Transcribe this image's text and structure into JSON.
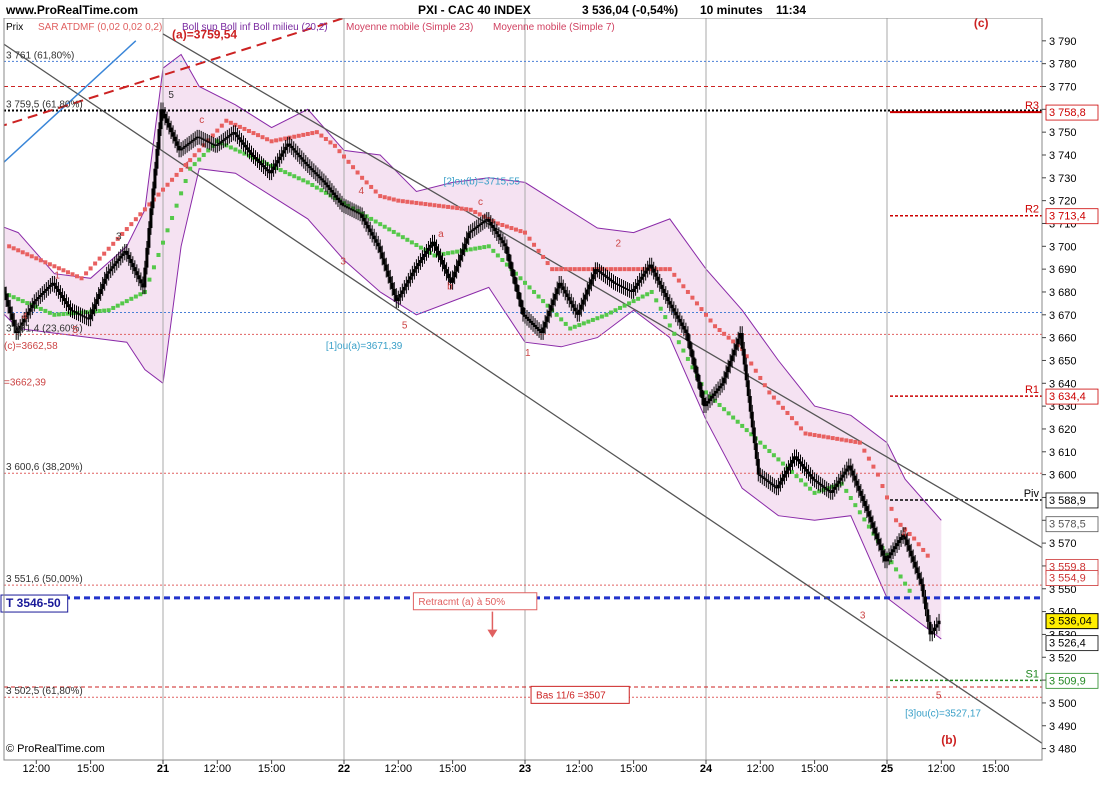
{
  "header": {
    "site": "www.ProRealTime.com",
    "symbol": "PXI - CAC 40 INDEX",
    "last": "3 536,04 (-0,54%)",
    "period": "10 minutes",
    "time": "11:34"
  },
  "legend": {
    "prix": "Prix",
    "sar": "SAR ATDMF (0,02 0,02 0,2)",
    "boll": "Boll sup Boll inf Boll milieu (20,2)",
    "mm23": "Moyenne mobile (Simple 23)",
    "mm7": "Moyenne mobile (Simple 7)"
  },
  "footer": {
    "copyright": "© ProRealTime.com"
  },
  "colors": {
    "candle": "#000000",
    "boll_fill": "#f5e2f2",
    "boll_line": "#8a2aa8",
    "sar_red": "#e86060",
    "sar_green": "#55c84a",
    "channel": "#555555",
    "fib": "#e06060",
    "support_blue": "#2233cc",
    "pivot": "#000000",
    "resistance": "#cc0000",
    "s1": "#228822",
    "price_box": "#ffee00"
  },
  "chart_data": {
    "type": "candlestick",
    "title": "PXI - CAC 40 INDEX",
    "ylim": [
      3475,
      3800
    ],
    "yticks": [
      "3 480",
      "3 490",
      "3 500",
      "3 510",
      "3 520",
      "3 530",
      "3 540",
      "3 550",
      "3 560",
      "3 570",
      "3 580",
      "3 590",
      "3 600",
      "3 610",
      "3 620",
      "3 630",
      "3 640",
      "3 650",
      "3 660",
      "3 670",
      "3 680",
      "3 690",
      "3 700",
      "3 710",
      "3 720",
      "3 730",
      "3 740",
      "3 750",
      "3 760",
      "3 770",
      "3 780",
      "3 790"
    ],
    "xticks": [
      {
        "label": "12:00",
        "x": 0.3
      },
      {
        "label": "15:00",
        "x": 0.6
      },
      {
        "label": "21",
        "x": 1.0
      },
      {
        "label": "12:00",
        "x": 1.3
      },
      {
        "label": "15:00",
        "x": 1.6
      },
      {
        "label": "22",
        "x": 2.0
      },
      {
        "label": "12:00",
        "x": 2.3
      },
      {
        "label": "15:00",
        "x": 2.6
      },
      {
        "label": "23",
        "x": 3.0
      },
      {
        "label": "12:00",
        "x": 3.3
      },
      {
        "label": "15:00",
        "x": 3.6
      },
      {
        "label": "24",
        "x": 4.0
      },
      {
        "label": "12:00",
        "x": 4.3
      },
      {
        "label": "15:00",
        "x": 4.6
      },
      {
        "label": "25",
        "x": 5.0
      },
      {
        "label": "12:00",
        "x": 5.3
      },
      {
        "label": "15:00",
        "x": 5.6
      }
    ],
    "day_separators": [
      1.0,
      2.0,
      3.0,
      4.0,
      5.0
    ],
    "close_path": [
      [
        0.0,
        3698
      ],
      [
        0.1,
        3688
      ],
      [
        0.2,
        3662
      ],
      [
        0.3,
        3676
      ],
      [
        0.4,
        3684
      ],
      [
        0.5,
        3672
      ],
      [
        0.6,
        3668
      ],
      [
        0.7,
        3688
      ],
      [
        0.8,
        3698
      ],
      [
        0.9,
        3682
      ],
      [
        1.0,
        3760
      ],
      [
        1.1,
        3742
      ],
      [
        1.2,
        3748
      ],
      [
        1.3,
        3744
      ],
      [
        1.4,
        3750
      ],
      [
        1.5,
        3740
      ],
      [
        1.6,
        3732
      ],
      [
        1.7,
        3745
      ],
      [
        1.8,
        3736
      ],
      [
        1.9,
        3728
      ],
      [
        2.0,
        3718
      ],
      [
        2.1,
        3714
      ],
      [
        2.2,
        3700
      ],
      [
        2.3,
        3676
      ],
      [
        2.4,
        3690
      ],
      [
        2.5,
        3702
      ],
      [
        2.6,
        3684
      ],
      [
        2.7,
        3706
      ],
      [
        2.8,
        3712
      ],
      [
        2.9,
        3700
      ],
      [
        3.0,
        3670
      ],
      [
        3.1,
        3662
      ],
      [
        3.2,
        3684
      ],
      [
        3.3,
        3670
      ],
      [
        3.4,
        3690
      ],
      [
        3.5,
        3684
      ],
      [
        3.6,
        3680
      ],
      [
        3.7,
        3692
      ],
      [
        3.8,
        3676
      ],
      [
        3.9,
        3662
      ],
      [
        4.0,
        3630
      ],
      [
        4.1,
        3640
      ],
      [
        4.2,
        3662
      ],
      [
        4.3,
        3600
      ],
      [
        4.4,
        3594
      ],
      [
        4.5,
        3608
      ],
      [
        4.6,
        3598
      ],
      [
        4.7,
        3592
      ],
      [
        4.8,
        3604
      ],
      [
        4.9,
        3584
      ],
      [
        5.0,
        3562
      ],
      [
        5.1,
        3574
      ],
      [
        5.2,
        3552
      ],
      [
        5.25,
        3530
      ],
      [
        5.3,
        3536
      ]
    ],
    "bollinger_upper": [
      [
        0.0,
        3712
      ],
      [
        0.2,
        3706
      ],
      [
        0.4,
        3688
      ],
      [
        0.6,
        3686
      ],
      [
        0.8,
        3700
      ],
      [
        0.9,
        3716
      ],
      [
        1.0,
        3778
      ],
      [
        1.1,
        3784
      ],
      [
        1.2,
        3770
      ],
      [
        1.4,
        3762
      ],
      [
        1.6,
        3752
      ],
      [
        1.8,
        3760
      ],
      [
        2.0,
        3742
      ],
      [
        2.2,
        3740
      ],
      [
        2.4,
        3724
      ],
      [
        2.6,
        3728
      ],
      [
        2.8,
        3730
      ],
      [
        3.0,
        3728
      ],
      [
        3.2,
        3718
      ],
      [
        3.4,
        3708
      ],
      [
        3.6,
        3706
      ],
      [
        3.8,
        3712
      ],
      [
        4.0,
        3690
      ],
      [
        4.2,
        3672
      ],
      [
        4.4,
        3650
      ],
      [
        4.6,
        3630
      ],
      [
        4.8,
        3626
      ],
      [
        5.0,
        3614
      ],
      [
        5.1,
        3598
      ],
      [
        5.3,
        3580
      ]
    ],
    "bollinger_lower": [
      [
        0.0,
        3680
      ],
      [
        0.2,
        3664
      ],
      [
        0.4,
        3662
      ],
      [
        0.6,
        3660
      ],
      [
        0.8,
        3658
      ],
      [
        0.9,
        3646
      ],
      [
        1.0,
        3640
      ],
      [
        1.1,
        3700
      ],
      [
        1.2,
        3734
      ],
      [
        1.4,
        3732
      ],
      [
        1.6,
        3722
      ],
      [
        1.8,
        3712
      ],
      [
        2.0,
        3694
      ],
      [
        2.2,
        3680
      ],
      [
        2.4,
        3670
      ],
      [
        2.6,
        3676
      ],
      [
        2.8,
        3682
      ],
      [
        3.0,
        3658
      ],
      [
        3.2,
        3656
      ],
      [
        3.4,
        3660
      ],
      [
        3.6,
        3672
      ],
      [
        3.8,
        3660
      ],
      [
        4.0,
        3624
      ],
      [
        4.2,
        3594
      ],
      [
        4.4,
        3582
      ],
      [
        4.6,
        3580
      ],
      [
        4.8,
        3582
      ],
      [
        5.0,
        3546
      ],
      [
        5.1,
        3540
      ],
      [
        5.3,
        3528
      ]
    ],
    "sar_red": [
      [
        0.15,
        3700
      ],
      [
        0.55,
        3686
      ],
      [
        1.35,
        3755
      ],
      [
        1.6,
        3746
      ],
      [
        1.85,
        3750
      ],
      [
        1.95,
        3744
      ],
      [
        2.1,
        3730
      ],
      [
        2.2,
        3722
      ],
      [
        2.3,
        3720
      ],
      [
        2.7,
        3716
      ],
      [
        2.85,
        3710
      ],
      [
        3.0,
        3706
      ],
      [
        3.15,
        3690
      ],
      [
        3.8,
        3690
      ],
      [
        4.05,
        3665
      ],
      [
        4.2,
        3655
      ],
      [
        4.35,
        3636
      ],
      [
        4.55,
        3618
      ],
      [
        4.85,
        3614
      ],
      [
        4.95,
        3600
      ],
      [
        5.05,
        3580
      ],
      [
        5.15,
        3572
      ],
      [
        5.25,
        3562
      ]
    ],
    "sar_green": [
      [
        0.05,
        3682
      ],
      [
        0.4,
        3670
      ],
      [
        0.7,
        3672
      ],
      [
        0.9,
        3680
      ],
      [
        1.15,
        3734
      ],
      [
        1.3,
        3746
      ],
      [
        1.8,
        3728
      ],
      [
        2.5,
        3696
      ],
      [
        2.8,
        3700
      ],
      [
        3.25,
        3664
      ],
      [
        3.45,
        3670
      ],
      [
        3.7,
        3680
      ],
      [
        4.0,
        3636
      ],
      [
        4.6,
        3592
      ],
      [
        4.75,
        3596
      ],
      [
        5.15,
        3546
      ]
    ],
    "channel_lines": [
      [
        [
          0.0,
          3795
        ],
        [
          5.9,
          3480
        ]
      ],
      [
        [
          1.0,
          3793
        ],
        [
          5.9,
          3566
        ]
      ]
    ],
    "trend_lines": [
      {
        "color": "#3a86d8",
        "style": "solid",
        "points": [
          [
            0.0,
            3728
          ],
          [
            0.85,
            3790
          ]
        ]
      },
      {
        "color": "#cc2222",
        "style": "dash",
        "points": [
          [
            0.0,
            3750
          ],
          [
            1.2,
            3780
          ],
          [
            2.0,
            3800
          ]
        ]
      }
    ],
    "horizontal_levels": [
      {
        "y": 3781,
        "label": "3 761 (61,80%)",
        "color": "#4a7fd6",
        "style": "dot"
      },
      {
        "y": 3770,
        "color": "#cc2222",
        "style": "dash"
      },
      {
        "y": 3759.5,
        "label": "3 759,5 (61,80%)",
        "color": "#000000",
        "style": "dot-thick"
      },
      {
        "y": 3758.8,
        "color": "#cc0000",
        "style": "solid-right",
        "tag": "R3"
      },
      {
        "y": 3713.4,
        "color": "#cc0000",
        "style": "dash-right",
        "tag": "R2"
      },
      {
        "y": 3671,
        "color": "#4a7fd6",
        "style": "dot"
      },
      {
        "y": 3661.4,
        "label": "3 661,4 (23,60%)",
        "color": "#e06060",
        "style": "dot"
      },
      {
        "y": 3634.4,
        "color": "#cc0000",
        "style": "dash-right",
        "tag": "R1"
      },
      {
        "y": 3600.6,
        "label": "3 600,6 (38,20%)",
        "color": "#e06060",
        "style": "dot"
      },
      {
        "y": 3588.9,
        "color": "#000000",
        "style": "dash-right",
        "tag": "Piv"
      },
      {
        "y": 3551.6,
        "label": "3 551,6 (50,00%)",
        "color": "#e06060",
        "style": "dot"
      },
      {
        "y": 3546,
        "color": "#2233cc",
        "style": "thick-dash"
      },
      {
        "y": 3509.9,
        "color": "#228822",
        "style": "dash-right",
        "tag": "S1"
      },
      {
        "y": 3507,
        "color": "#cc2222",
        "style": "dash"
      },
      {
        "y": 3502.5,
        "label": "3 502,5 (61,80%)",
        "color": "#e06060",
        "style": "dot"
      }
    ],
    "right_tags": [
      {
        "y": 3758.8,
        "text": "3 758,8",
        "color": "#cc0000"
      },
      {
        "y": 3713.4,
        "text": "3 713,4",
        "color": "#cc0000"
      },
      {
        "y": 3634.4,
        "text": "3 634,4",
        "color": "#cc0000"
      },
      {
        "y": 3588.9,
        "text": "3 588,9",
        "color": "#000000"
      },
      {
        "y": 3578.5,
        "text": "3 578,5",
        "color": "#555555"
      },
      {
        "y": 3559.8,
        "text": "3 559,8",
        "color": "#cc3333"
      },
      {
        "y": 3554.9,
        "text": "3 554,9",
        "color": "#cc3333"
      },
      {
        "y": 3536.04,
        "text": "3 536,04",
        "color": "#000000",
        "box": "#ffee00"
      },
      {
        "y": 3526.4,
        "text": "3 526,4",
        "color": "#000000"
      },
      {
        "y": 3509.9,
        "text": "3 509,9",
        "color": "#228822"
      }
    ],
    "annotations": [
      {
        "text": "(a)=3759,54",
        "x": 1.05,
        "y": 3791,
        "color": "#cc2222",
        "bold": true
      },
      {
        "text": "(c)",
        "x": 5.48,
        "y": 3796,
        "color": "#cc2222",
        "bold": true
      },
      {
        "text": "(b)",
        "x": 5.3,
        "y": 3482,
        "color": "#cc2222",
        "bold": true
      },
      {
        "text": "(c)=3662,58",
        "x": 0.05,
        "y": 3655,
        "color": "#cc4444"
      },
      {
        "text": "=3662,39",
        "x": -0.03,
        "y": 3639,
        "color": "#cc4444"
      },
      {
        "text": "[2]ou(b)=3715,55",
        "x": 2.55,
        "y": 3727,
        "color": "#3aa0c8"
      },
      {
        "text": "[1]ou(a)=3671,39",
        "x": 1.9,
        "y": 3655,
        "color": "#3aa0c8"
      },
      {
        "text": "[3]ou(c)=3527,17",
        "x": 5.1,
        "y": 3494,
        "color": "#3aa0c8"
      },
      {
        "text": "T 3546-50",
        "x": -0.03,
        "y": 3542,
        "color": "#1a1a99",
        "bold": true,
        "boxed": true
      },
      {
        "text": "Retracmt (a) à 50%",
        "x": 2.4,
        "y": 3543,
        "color": "#e06060",
        "boxed": true
      },
      {
        "text": "Bas 11/6 =3507",
        "x": 3.05,
        "y": 3502,
        "color": "#cc2222",
        "boxed": true
      },
      {
        "text": "5",
        "x": 1.03,
        "y": 3765,
        "color": "#333333"
      },
      {
        "text": "3",
        "x": 0.74,
        "y": 3703,
        "color": "#333333"
      },
      {
        "text": "1",
        "x": 0.4,
        "y": 3686,
        "color": "#cc4444"
      },
      {
        "text": "4",
        "x": 0.22,
        "y": 3668,
        "color": "#cc4444"
      },
      {
        "text": "5",
        "x": 0.5,
        "y": 3662,
        "color": "#cc4444"
      },
      {
        "text": "1",
        "x": 1.12,
        "y": 3734,
        "color": "#cc4444"
      },
      {
        "text": "c",
        "x": 1.2,
        "y": 3754,
        "color": "#cc4444"
      },
      {
        "text": "3",
        "x": 1.98,
        "y": 3692,
        "color": "#cc4444"
      },
      {
        "text": "4",
        "x": 2.08,
        "y": 3723,
        "color": "#cc4444"
      },
      {
        "text": "5",
        "x": 2.32,
        "y": 3664,
        "color": "#cc4444"
      },
      {
        "text": "a",
        "x": 2.52,
        "y": 3704,
        "color": "#cc4444"
      },
      {
        "text": "b",
        "x": 2.57,
        "y": 3681,
        "color": "#cc4444"
      },
      {
        "text": "c",
        "x": 2.74,
        "y": 3718,
        "color": "#cc4444"
      },
      {
        "text": "2",
        "x": 3.5,
        "y": 3700,
        "color": "#cc4444"
      },
      {
        "text": "1",
        "x": 3.0,
        "y": 3652,
        "color": "#cc4444"
      },
      {
        "text": "3",
        "x": 4.85,
        "y": 3537,
        "color": "#cc4444"
      },
      {
        "text": "4",
        "x": 5.08,
        "y": 3573,
        "color": "#cc4444"
      },
      {
        "text": "5",
        "x": 5.27,
        "y": 3502,
        "color": "#cc4444"
      }
    ]
  }
}
